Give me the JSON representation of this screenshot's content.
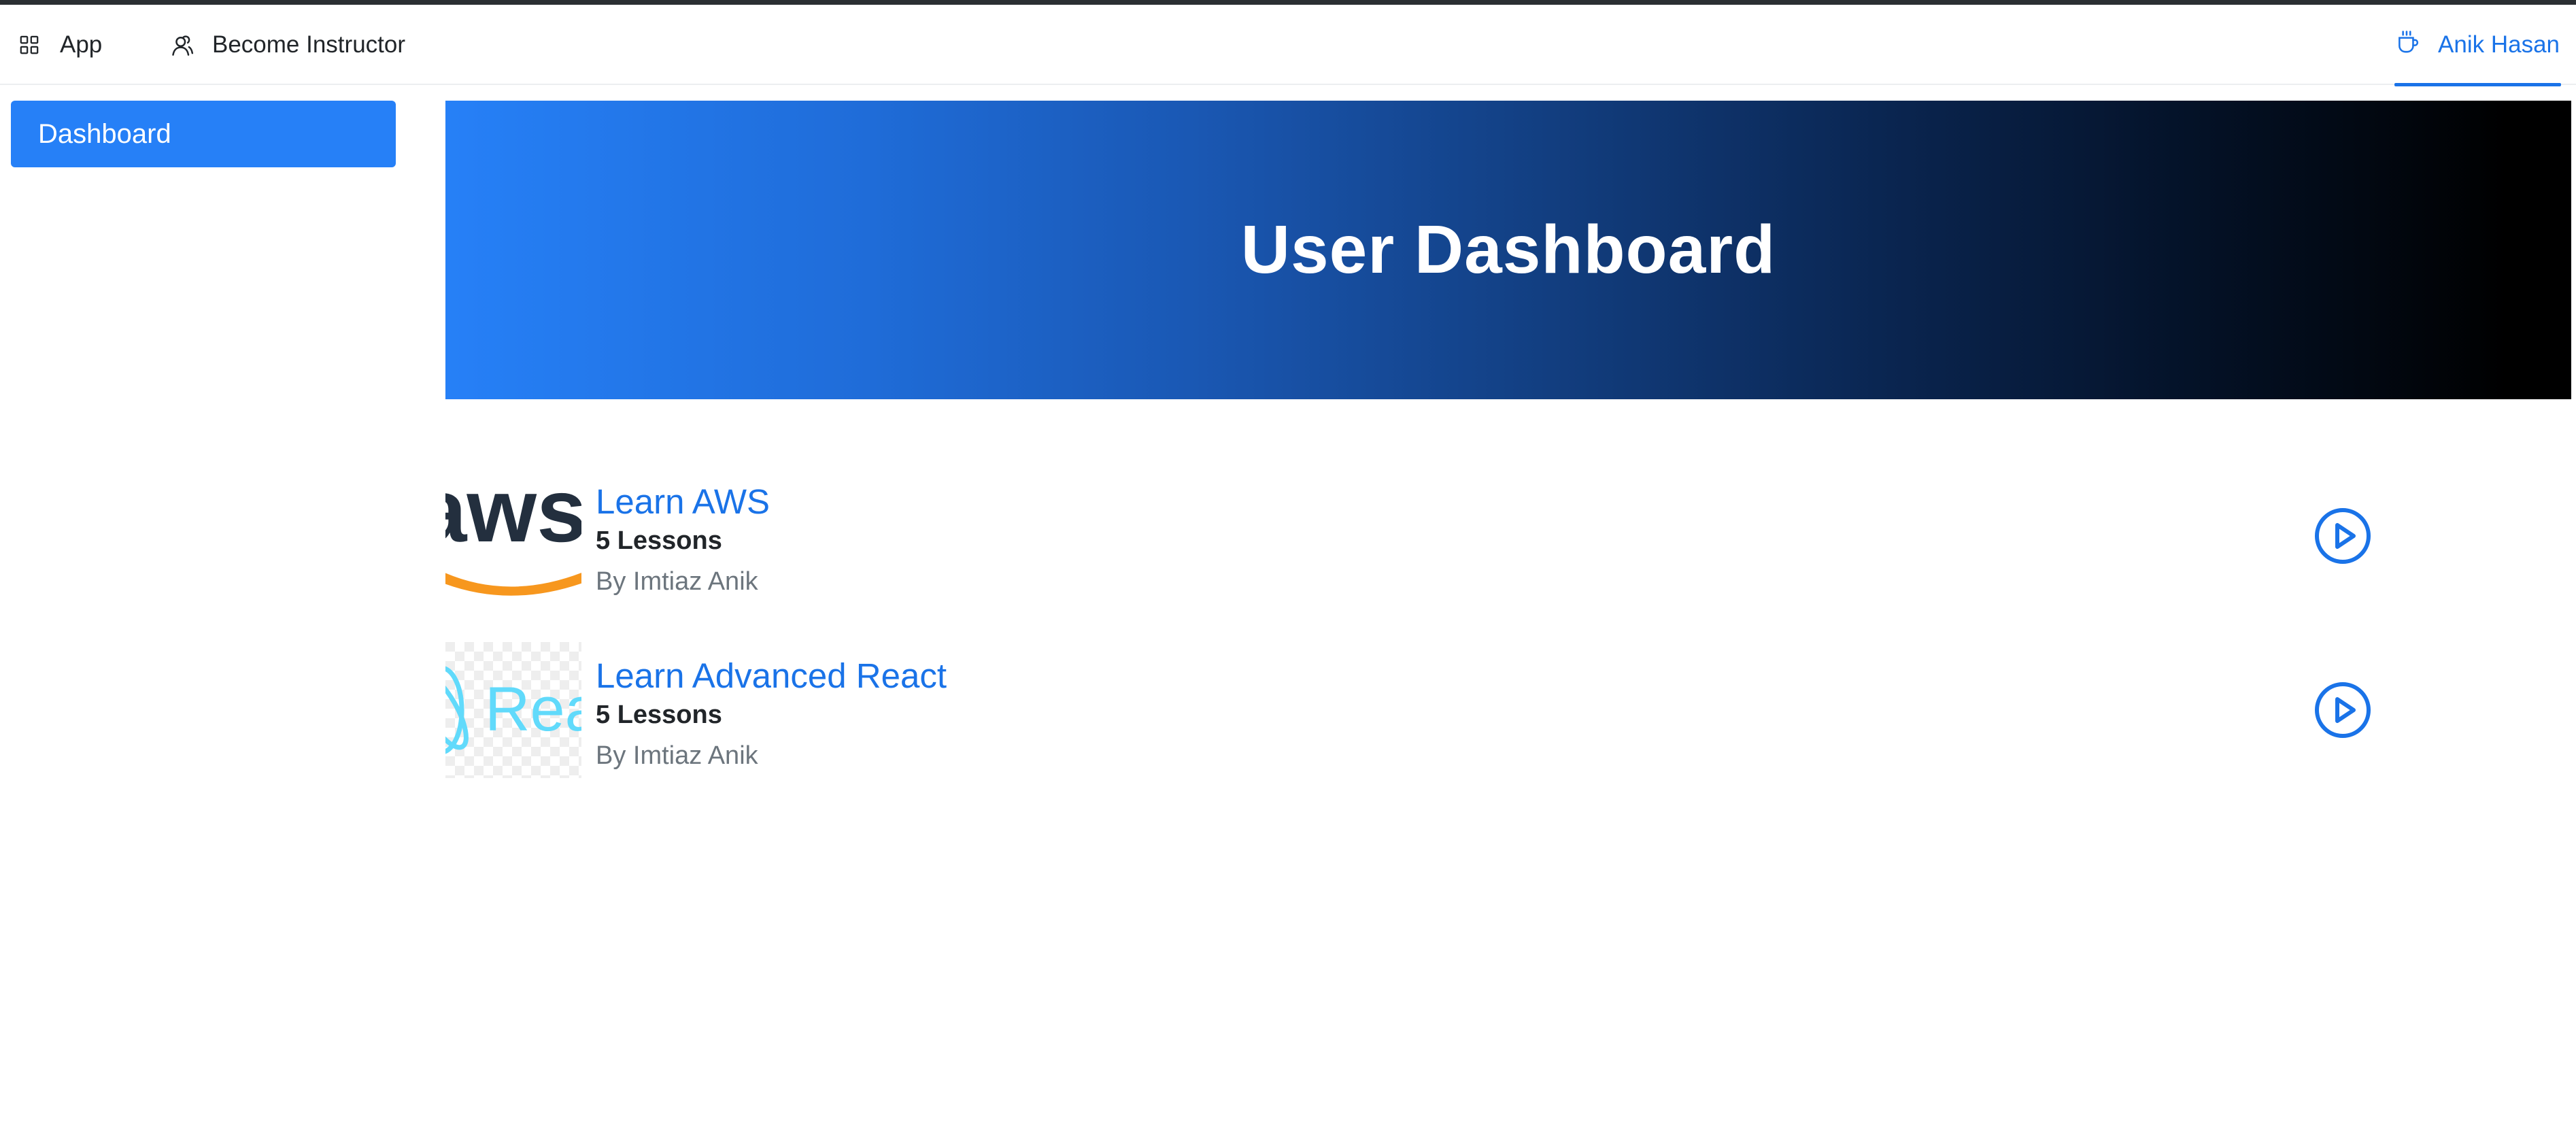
{
  "header": {
    "app_label": "App",
    "instructor_label": "Become Instructor",
    "user_name": "Anik Hasan"
  },
  "sidebar": {
    "items": [
      {
        "label": "Dashboard",
        "active": true
      }
    ]
  },
  "banner": {
    "title": "User Dashboard"
  },
  "courses": [
    {
      "title": "Learn AWS",
      "lessons": "5 Lessons",
      "author": "By Imtiaz Anik",
      "thumbnail_text": "aws",
      "icon": "play-circle-icon"
    },
    {
      "title": "Learn Advanced React",
      "lessons": "5 Lessons",
      "author": "By Imtiaz Anik",
      "thumbnail_text": "Rea",
      "icon": "play-circle-icon"
    }
  ],
  "colors": {
    "accent": "#1a73e8",
    "sidebar_active": "#2680f7",
    "banner_gradient_start": "#2680f7",
    "banner_gradient_end": "#000000",
    "muted_text": "#6c757d"
  }
}
